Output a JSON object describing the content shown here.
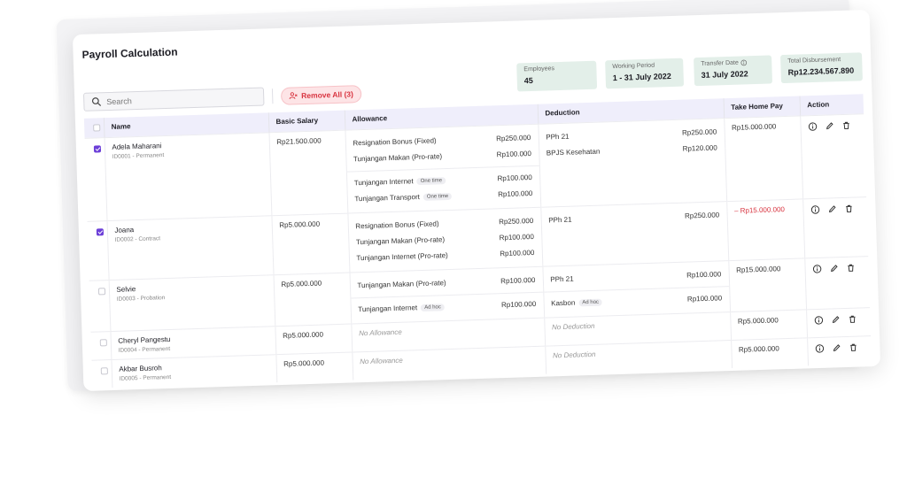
{
  "page": {
    "title": "Payroll Calculation"
  },
  "search": {
    "placeholder": "Search"
  },
  "toolbar": {
    "remove_all_label": "Remove All (3)"
  },
  "stats": [
    {
      "label": "Employees",
      "value": "45"
    },
    {
      "label": "Working Period",
      "value": "1 - 31 July 2022"
    },
    {
      "label": "Transfer Date",
      "value": "31 July 2022"
    },
    {
      "label": "Total Disbursement",
      "value": "Rp12.234.567.890"
    }
  ],
  "table": {
    "headers": [
      "Name",
      "Basic Salary",
      "Allowance",
      "Deduction",
      "Take Home Pay",
      "Action"
    ],
    "rows": [
      {
        "name": "Adela Maharani",
        "sub": "ID0001 - Permanent",
        "checked": true,
        "basic": "Rp21.500.000",
        "allowance_group1": [
          {
            "label": "Resignation Bonus (Fixed)",
            "amount": "Rp250.000"
          },
          {
            "label": "Tunjangan Makan (Pro-rate)",
            "amount": "Rp100.000"
          }
        ],
        "allowance_group2": [
          {
            "label": "Tunjangan Internet",
            "tag": "One time",
            "amount": "Rp100.000"
          },
          {
            "label": "Tunjangan Transport",
            "tag": "One time",
            "amount": "Rp100.000"
          }
        ],
        "deductions": [
          {
            "label": "PPh 21",
            "amount": "Rp250.000"
          },
          {
            "label": "BPJS Kesehatan",
            "amount": "Rp120.000"
          }
        ],
        "thp": "Rp15.000.000"
      },
      {
        "name": "Joana",
        "sub": "ID0002 - Contract",
        "checked": true,
        "basic": "Rp5.000.000",
        "allowance_group1": [
          {
            "label": "Resignation Bonus (Fixed)",
            "amount": "Rp250.000"
          },
          {
            "label": "Tunjangan Makan (Pro-rate)",
            "amount": "Rp100.000"
          },
          {
            "label": "Tunjangan Internet (Pro-rate)",
            "amount": "Rp100.000"
          }
        ],
        "deductions": [
          {
            "label": "PPh 21",
            "amount": "Rp250.000"
          }
        ],
        "thp": "– Rp15.000.000"
      },
      {
        "name": "Selvie",
        "sub": "ID0003 - Probation",
        "checked": false,
        "basic": "Rp5.000.000",
        "allowance_group1": [
          {
            "label": "Tunjangan Makan (Pro-rate)",
            "amount": "Rp100.000"
          }
        ],
        "allowance_group2": [
          {
            "label": "Tunjangan Internet",
            "tag": "Ad hoc",
            "amount": "Rp100.000"
          }
        ],
        "deductions": [
          {
            "label": "PPh 21",
            "amount": "Rp100.000"
          }
        ],
        "deductions2": [
          {
            "label": "Kasbon",
            "tag": "Ad hoc",
            "amount": "Rp100.000"
          }
        ],
        "thp": "Rp15.000.000"
      },
      {
        "name": "Cheryl Pangestu",
        "sub": "ID0004 - Permanent",
        "checked": false,
        "basic": "Rp5.000.000",
        "no_allowance": "No Allowance",
        "no_deduction": "No Deduction",
        "thp": "Rp5.000.000"
      },
      {
        "name": "Akbar Busroh",
        "sub": "ID0005 - Permanent",
        "checked": false,
        "basic": "Rp5.000.000",
        "no_allowance": "No Allowance",
        "no_deduction": "No Deduction",
        "thp": "Rp5.000.000"
      }
    ]
  },
  "icons": {
    "info": "info-icon",
    "edit": "pencil-icon",
    "delete": "trash-icon"
  },
  "colors": {
    "accent": "#6c3fd8",
    "danger": "#d8333f",
    "stat_bg": "#e3efe9",
    "header_bg": "#efeefb"
  }
}
